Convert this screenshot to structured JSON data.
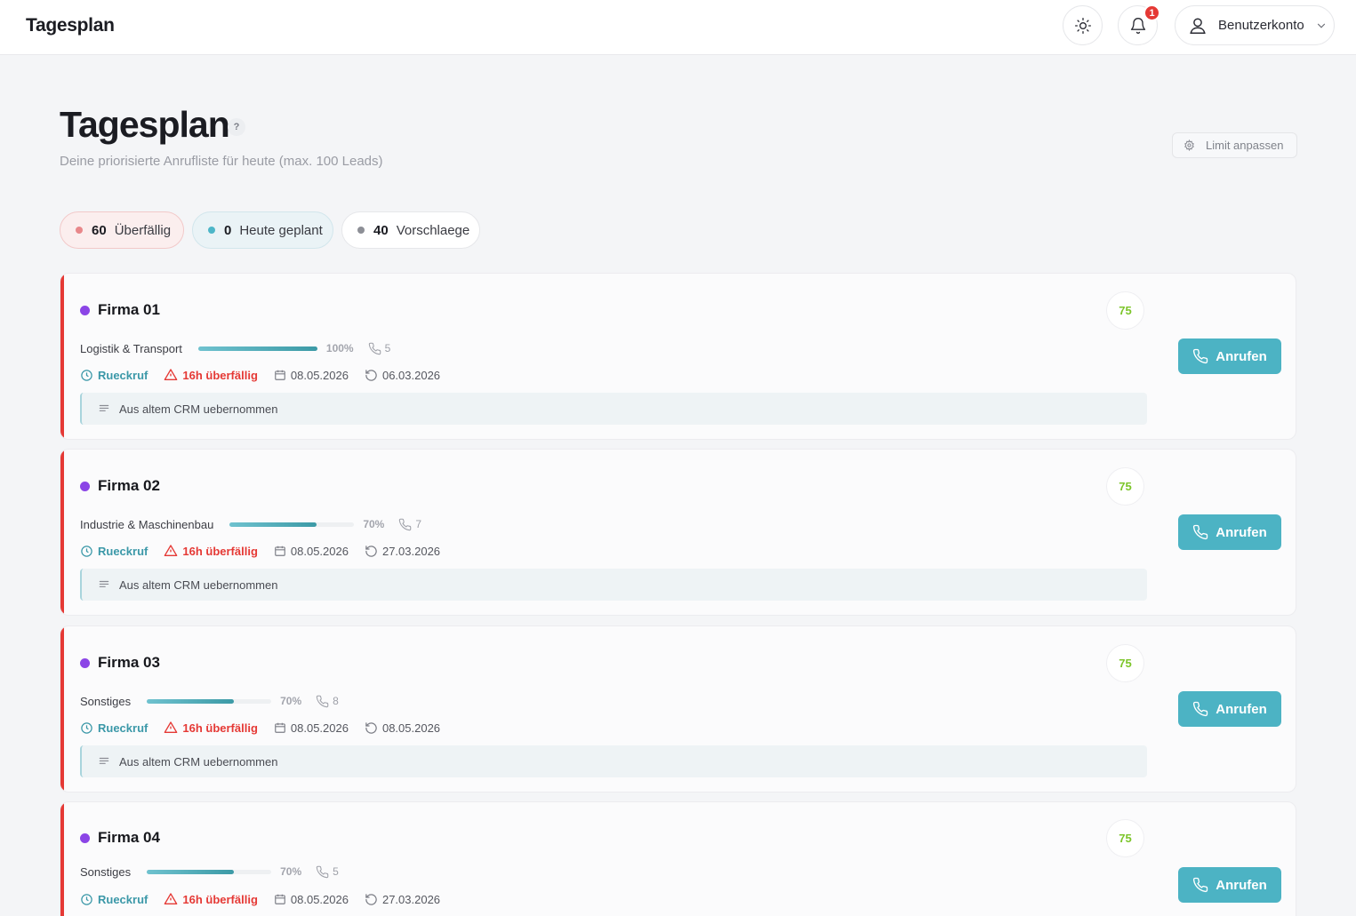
{
  "header": {
    "app_title": "Tagesplan",
    "notification_count": "1",
    "account_label": "Benutzerkonto"
  },
  "page": {
    "title": "Tagesplan",
    "help": "?",
    "subtitle": "Deine priorisierte Anrufliste für heute (max. 100 Leads)",
    "limit_button": "Limit anpassen"
  },
  "filters": [
    {
      "count": "60",
      "label": "Überfällig",
      "dot_color": "#e8878a"
    },
    {
      "count": "0",
      "label": "Heute geplant",
      "dot_color": "#4db6c8"
    },
    {
      "count": "40",
      "label": "Vorschlaege",
      "dot_color": "#8d8f96"
    }
  ],
  "colors": {
    "accent": "#4cb3c4",
    "overdue": "#e53935",
    "score": "#7cc52a",
    "lead_dot": "#8b45e6"
  },
  "leads": [
    {
      "name": "Firma 01",
      "score": "75",
      "industry": "Logistik & Transport",
      "progress": 100,
      "progress_label": "100%",
      "calls": "5",
      "status": "Rueckruf",
      "overdue": "16h überfällig",
      "date": "08.05.2026",
      "last_contact": "06.03.2026",
      "note": "Aus altem CRM uebernommen",
      "button": "Anrufen"
    },
    {
      "name": "Firma 02",
      "score": "75",
      "industry": "Industrie & Maschinenbau",
      "progress": 70,
      "progress_label": "70%",
      "calls": "7",
      "status": "Rueckruf",
      "overdue": "16h überfällig",
      "date": "08.05.2026",
      "last_contact": "27.03.2026",
      "note": "Aus altem CRM uebernommen",
      "button": "Anrufen"
    },
    {
      "name": "Firma 03",
      "score": "75",
      "industry": "Sonstiges",
      "progress": 70,
      "progress_label": "70%",
      "calls": "8",
      "status": "Rueckruf",
      "overdue": "16h überfällig",
      "date": "08.05.2026",
      "last_contact": "08.05.2026",
      "note": "Aus altem CRM uebernommen",
      "button": "Anrufen"
    },
    {
      "name": "Firma 04",
      "score": "75",
      "industry": "Sonstiges",
      "progress": 70,
      "progress_label": "70%",
      "calls": "5",
      "status": "Rueckruf",
      "overdue": "16h überfällig",
      "date": "08.05.2026",
      "last_contact": "27.03.2026",
      "note": "",
      "button": "Anrufen"
    }
  ]
}
